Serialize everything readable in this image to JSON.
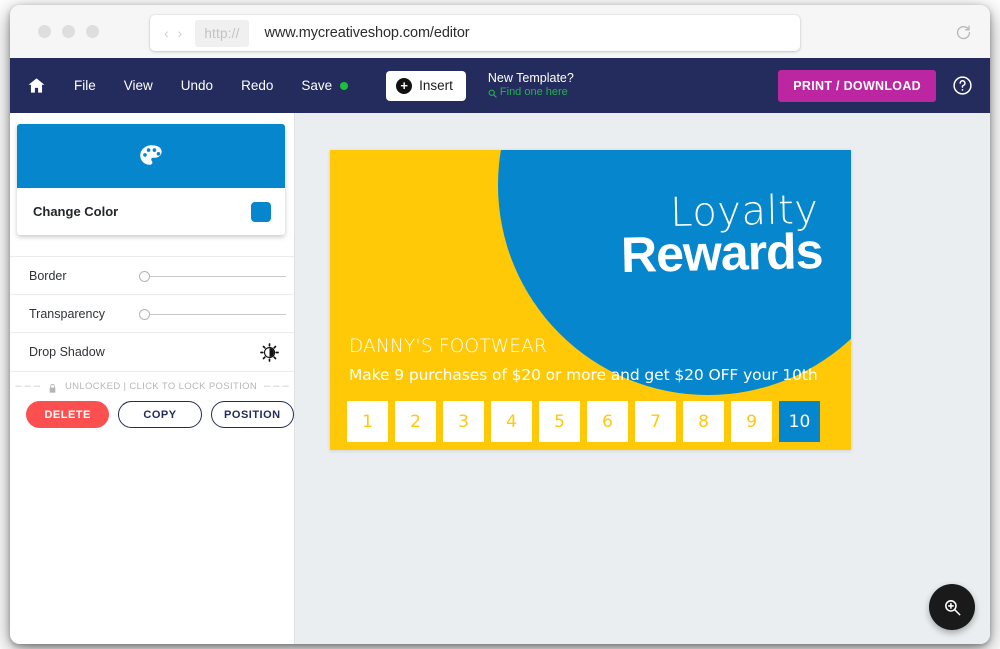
{
  "browser": {
    "back_label": "‹",
    "forward_label": "›",
    "scheme": "http://",
    "url": "www.mycreativeshop.com/editor",
    "reload_icon": "reload-icon",
    "traffic_lights": [
      "close",
      "minimize",
      "maximize"
    ]
  },
  "toolbar": {
    "home_icon": "home-icon",
    "menu": [
      "File",
      "View",
      "Undo",
      "Redo"
    ],
    "save_label": "Save",
    "save_status_color": "#19c13a",
    "insert_label": "Insert",
    "insert_icon": "plus-circle-icon",
    "new_template_title": "New Template?",
    "new_template_link": "Find one here",
    "new_template_link_icon": "search-icon",
    "print_label": "PRINT / DOWNLOAD",
    "help_icon": "question-circle-icon",
    "accent_navy": "#232C5C",
    "accent_magenta": "#BC26A0",
    "accent_green": "#24B14C"
  },
  "sidebar": {
    "color_card": {
      "header_icon": "palette-icon",
      "header_color": "#0686CC",
      "label": "Change Color",
      "swatch_color": "#0686CC"
    },
    "options": [
      {
        "label": "Border",
        "control": "slider",
        "value": 0
      },
      {
        "label": "Transparency",
        "control": "slider",
        "value": 0
      },
      {
        "label": "Drop Shadow",
        "control": "toggle-icon",
        "icon": "contrast-icon"
      }
    ],
    "lock": {
      "icon": "lock-icon",
      "text": "UNLOCKED | CLICK TO LOCK POSITION",
      "left_dashes": "–  –  –",
      "right_dashes": "–  –  –"
    },
    "actions": [
      {
        "label": "DELETE",
        "style": "danger"
      },
      {
        "label": "COPY",
        "style": "outline"
      },
      {
        "label": "POSITION",
        "style": "outline"
      }
    ]
  },
  "canvas": {
    "background_color": "#EAEEF0",
    "zoom_button_icon": "zoom-in-icon"
  },
  "card": {
    "background_color": "#FFC907",
    "circle_color": "#0686CC",
    "heading_line1": "Loyalty",
    "heading_line2": "Rewards",
    "business_name": "DANNY'S FOOTWEAR",
    "offer_text": "Make 9 purchases of $20 or more and get $20 OFF your 10th",
    "stamps": [
      {
        "number": "1",
        "filled": false
      },
      {
        "number": "2",
        "filled": false
      },
      {
        "number": "3",
        "filled": false
      },
      {
        "number": "4",
        "filled": false
      },
      {
        "number": "5",
        "filled": false
      },
      {
        "number": "6",
        "filled": false
      },
      {
        "number": "7",
        "filled": false
      },
      {
        "number": "8",
        "filled": false
      },
      {
        "number": "9",
        "filled": false
      },
      {
        "number": "10",
        "filled": true
      }
    ]
  }
}
